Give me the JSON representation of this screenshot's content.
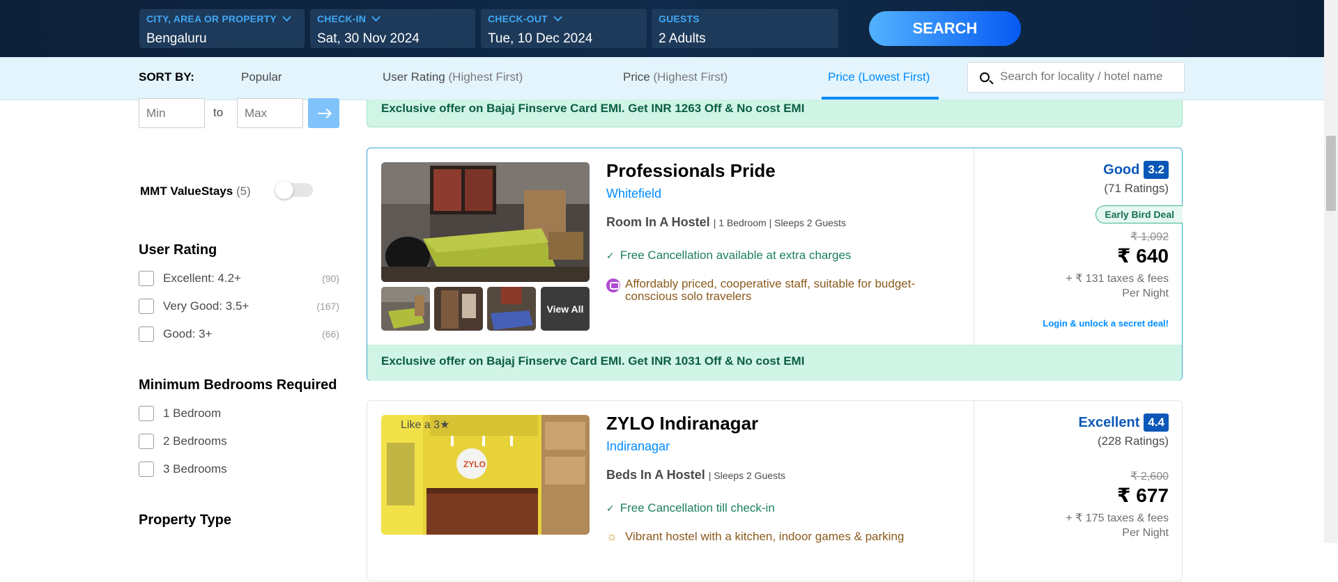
{
  "search": {
    "city": {
      "label": "CITY, AREA OR PROPERTY",
      "value": "Bengaluru"
    },
    "checkin": {
      "label": "CHECK-IN",
      "value": "Sat, 30 Nov 2024"
    },
    "checkout": {
      "label": "CHECK-OUT",
      "value": "Tue, 10 Dec 2024"
    },
    "guests": {
      "label": "GUESTS",
      "value": "2 Adults"
    },
    "button": "SEARCH"
  },
  "sort": {
    "title": "SORT BY:",
    "options": [
      {
        "main": "Popular",
        "sub": ""
      },
      {
        "main": "User Rating",
        "sub": "(Highest First)"
      },
      {
        "main": "Price",
        "sub": "(Highest First)"
      },
      {
        "main": "Price",
        "sub": "(Lowest First)"
      }
    ],
    "active_index": 3,
    "locality_placeholder": "Search for locality / hotel name"
  },
  "sidebar": {
    "price_min_placeholder": "Min",
    "price_to": "to",
    "price_max_placeholder": "Max",
    "valuestays": {
      "label": "MMT ValueStays",
      "count": "(5)",
      "on": false
    },
    "user_rating": {
      "title": "User Rating",
      "items": [
        {
          "label": "Excellent: 4.2+",
          "count": "(90)"
        },
        {
          "label": "Very Good: 3.5+",
          "count": "(167)"
        },
        {
          "label": "Good: 3+",
          "count": "(66)"
        }
      ]
    },
    "bedrooms": {
      "title": "Minimum Bedrooms Required",
      "items": [
        {
          "label": "1 Bedroom"
        },
        {
          "label": "2 Bedrooms"
        },
        {
          "label": "3 Bedrooms"
        }
      ]
    },
    "property_type": {
      "title": "Property Type"
    }
  },
  "top_offer": "Exclusive offer on Bajaj Finserve Card EMI. Get INR 1263 Off & No cost EMI",
  "hotels": [
    {
      "name": "Professionals Pride",
      "location": "Whitefield",
      "room_type": "Room In A Hostel",
      "room_details": "| 1 Bedroom | Sleeps 2 Guests",
      "cancellation": "Free Cancellation available at extra charges",
      "description": "Affordably priced, cooperative staff, suitable for budget-conscious solo travelers",
      "rating_text": "Good",
      "rating_score": "3.2",
      "rating_count": "(71 Ratings)",
      "deal_badge": "Early Bird Deal",
      "price_original": "₹ 1,092",
      "price_now": "₹ 640",
      "taxes": "+ ₹ 131 taxes & fees",
      "per_night": "Per Night",
      "secret_deal": "Login & unlock a secret deal!",
      "view_all": "View All",
      "offer": "Exclusive offer on Bajaj Finserve Card EMI. Get INR 1031 Off & No cost EMI"
    },
    {
      "name": "ZYLO Indiranagar",
      "star_label": "Like a 3★",
      "location": "Indiranagar",
      "room_type": "Beds In A Hostel",
      "room_details": "| Sleeps 2 Guests",
      "cancellation": "Free Cancellation till check-in",
      "description": "Vibrant hostel with a kitchen, indoor games & parking",
      "rating_text": "Excellent",
      "rating_score": "4.4",
      "rating_count": "(228 Ratings)",
      "price_original": "₹ 2,600",
      "price_now": "₹ 677",
      "taxes": "+ ₹ 175 taxes & fees",
      "per_night": "Per Night"
    }
  ],
  "colors": {
    "brand_blue": "#008cff",
    "header_navy": "#0c2541",
    "rating_blue": "#0b58b8",
    "offer_green_bg": "#d0f4e6"
  }
}
